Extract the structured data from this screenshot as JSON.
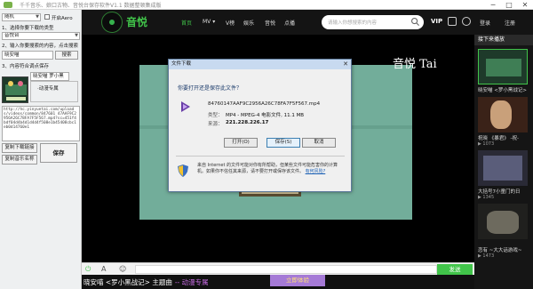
{
  "window": {
    "title": "千千音乐、娘口古物、音悦台保存软件V1.1 数据整顿集成版",
    "minimize": "─",
    "maximize": "□",
    "close": "✕"
  },
  "tool": {
    "source_select": "随机",
    "auto_label": "开启Aero",
    "step1_label": "1、选择你要下载的类型",
    "type_select": "音悦台",
    "step2_label": "2、输入你要搜索的内容，点击搜索",
    "query_value": "晓安喵",
    "search_button": "搜索",
    "step3_label": "3、内容符合调点保存",
    "result_title": "晓安喵 罗小黑",
    "result_caption": "·动漫专属",
    "url_text": "http://hc.yinyuetai.com/uploads/videos/common/847601 47AAF9C2956A26C78FA7F5F567.mp4?sc=451f4bdf04d4b4d1d4d4f508e1b45408cbc1eb0d14760e1",
    "copy_button": "复制下载链接",
    "save_button": "保存",
    "copy_name_button": "复制音乐名称"
  },
  "site": {
    "brand": "音悦",
    "nav": [
      "首页",
      "MV ▾",
      "V榜",
      "娱乐",
      "音悦",
      "点播"
    ],
    "search_placeholder": "请输入你想搜索的内容",
    "vip": "VIP",
    "login": "登录",
    "register": "注册",
    "overlay_title": "音悦 Tai"
  },
  "dialog": {
    "title": "文件下载",
    "close": "✕",
    "question": "你要打开还是保存此文件？",
    "filename": "84760147AAF9C2956A26C78FA7F5F567.mp4",
    "type_label": "类型：",
    "type_value": "MP4 - MPEG-4 电影文件, 11.1 MB",
    "from_label": "来源：",
    "from_value": "221.228.226.17",
    "open_button": "打开(O)",
    "save_button": "保存(S)",
    "cancel_button": "取消",
    "warning": "来自 Internet 的文件可能对你有所帮助，但某些文件可能危害你的计算机。如果你不信任其来源，请不要打开或保存该文件。",
    "warning_link": "有何风险?"
  },
  "player": {
    "send_button": "发送"
  },
  "song": {
    "title": "晓安喵 <罗小黑战记> 主题曲",
    "tag": "-- 动漫专属",
    "experience_button": "立即体验"
  },
  "sidebar": {
    "next_label": "接下来播放",
    "items": [
      {
        "caption": "晓安喵 <罗小黑战记>",
        "count": ""
      },
      {
        "caption": "祝晓 《暴君》 -祝-",
        "count": "▶ 1073"
      },
      {
        "caption": "大括号7小童门的日",
        "count": "▶ 1345"
      },
      {
        "caption": "恋有 ~大大话游戏~",
        "count": "▶ 1473"
      }
    ]
  },
  "colors": {
    "accent_green": "#41c44a",
    "stage": "#72ad9a",
    "experience": "#a57ad6"
  }
}
